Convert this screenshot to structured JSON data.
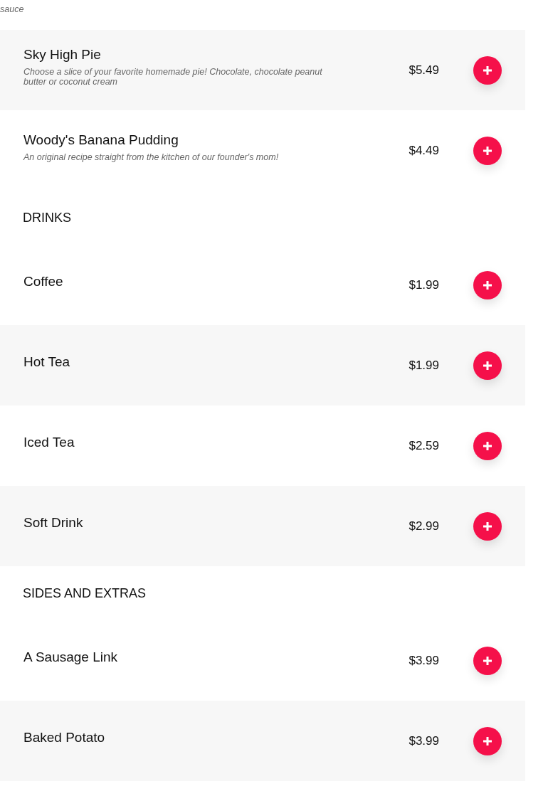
{
  "sections": [
    {
      "items": [
        {
          "kind": "fragment",
          "description": "sauce"
        },
        {
          "kind": "item",
          "name": "Sky High Pie",
          "description": "Choose a slice of your favorite homemade pie! Chocolate, chocolate peanut butter or coconut cream",
          "price": "$5.49"
        },
        {
          "kind": "item",
          "name": "Woody's Banana Pudding",
          "description": "An original recipe straight from the kitchen of our founder's mom!",
          "price": "$4.49"
        }
      ]
    },
    {
      "title": "DRINKS",
      "items": [
        {
          "kind": "item",
          "name": "Coffee",
          "price": "$1.99"
        },
        {
          "kind": "item",
          "name": "Hot Tea",
          "price": "$1.99"
        },
        {
          "kind": "item",
          "name": "Iced Tea",
          "price": "$2.59"
        },
        {
          "kind": "item",
          "name": "Soft Drink",
          "price": "$2.99"
        }
      ]
    },
    {
      "title": "SIDES AND EXTRAS",
      "items": [
        {
          "kind": "item",
          "name": "A Sausage Link",
          "price": "$3.99"
        },
        {
          "kind": "item",
          "name": "Baked Potato",
          "price": "$3.99"
        }
      ]
    }
  ]
}
